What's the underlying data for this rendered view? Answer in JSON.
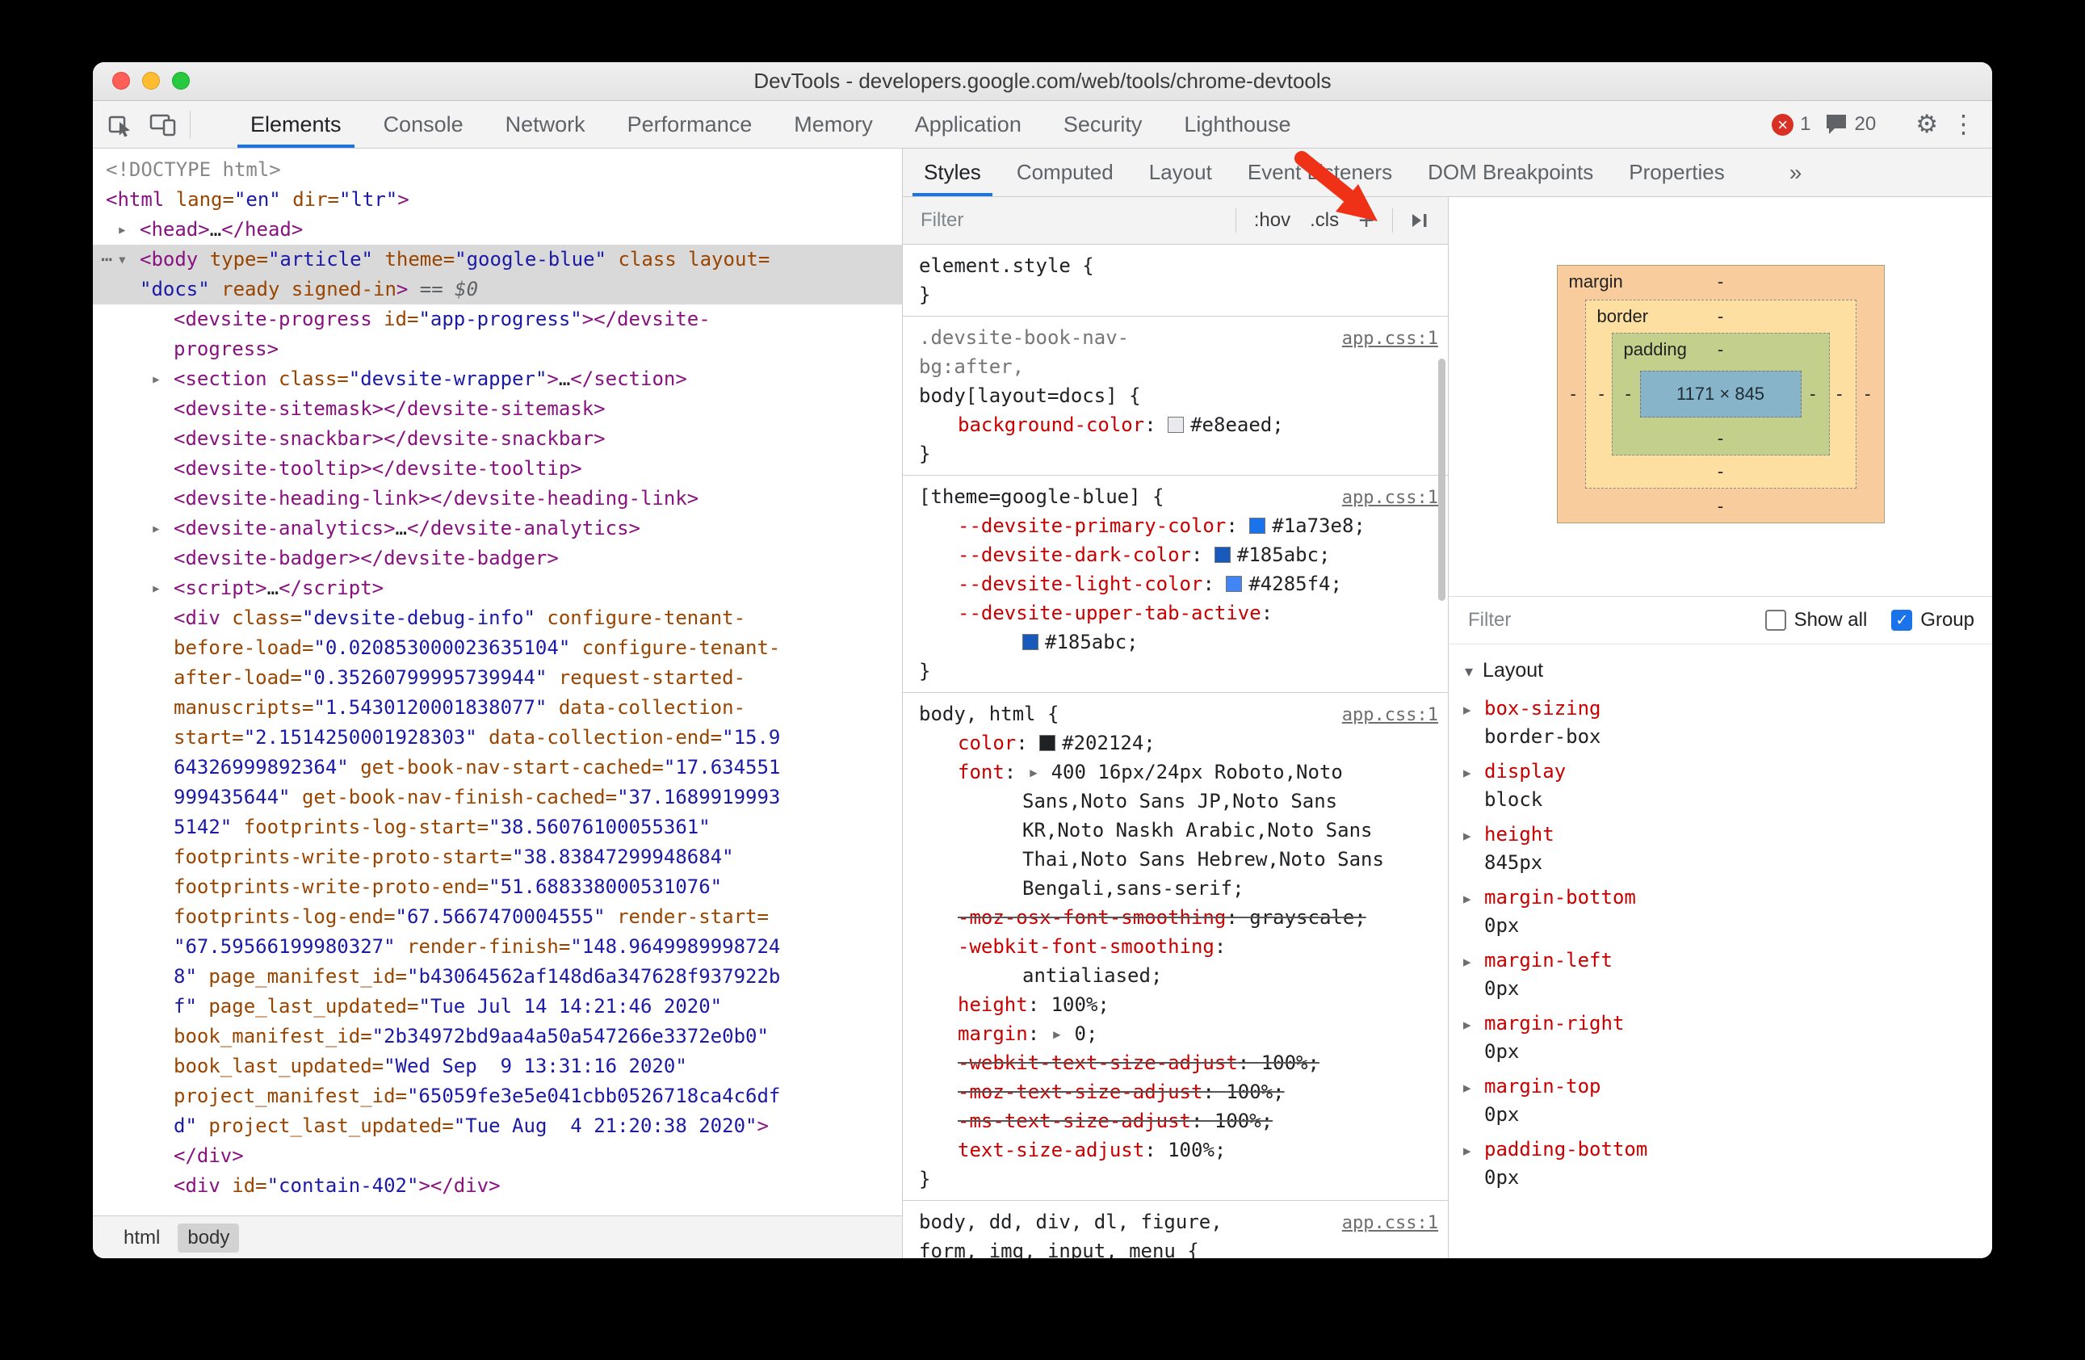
{
  "window": {
    "title": "DevTools - developers.google.com/web/tools/chrome-devtools"
  },
  "colors": {
    "accent": "#1a73e8",
    "error": "#d93025",
    "annotation_arrow": "#ee3117"
  },
  "icons": {
    "expand": "▸",
    "collapse": "▾",
    "more": "⋯",
    "gear": "⚙",
    "kebab": "⋮",
    "close": "×",
    "check": "✓"
  },
  "toolbar": {
    "tabs": [
      {
        "label": "Elements",
        "active": true
      },
      {
        "label": "Console"
      },
      {
        "label": "Network"
      },
      {
        "label": "Performance"
      },
      {
        "label": "Memory"
      },
      {
        "label": "Application"
      },
      {
        "label": "Security"
      },
      {
        "label": "Lighthouse"
      }
    ],
    "error_count": "1",
    "issue_count": "20"
  },
  "sidebar": {
    "tabs": [
      {
        "label": "Styles",
        "active": true
      },
      {
        "label": "Computed"
      },
      {
        "label": "Layout"
      },
      {
        "label": "Event Listeners"
      },
      {
        "label": "DOM Breakpoints"
      },
      {
        "label": "Properties"
      }
    ],
    "overflow": "»"
  },
  "elements_pane": {
    "lines": [
      {
        "i": 0,
        "s": [
          [
            "g",
            "<!DOCTYPE html>"
          ]
        ]
      },
      {
        "i": 0,
        "s": [
          [
            "t",
            "<html"
          ],
          [
            "a",
            " lang="
          ],
          [
            "v",
            "\"en\""
          ],
          [
            "a",
            " dir="
          ],
          [
            "v",
            "\"ltr\""
          ],
          [
            "t",
            ">"
          ]
        ]
      },
      {
        "i": 1,
        "arrow": "r",
        "s": [
          [
            "t",
            "<head>"
          ],
          [
            "p",
            "…"
          ],
          [
            "t",
            "</head>"
          ]
        ]
      },
      {
        "i": 1,
        "arrow": "d",
        "gutter": "⋯",
        "sel": true,
        "s": [
          [
            "t",
            "<body"
          ],
          [
            "a",
            " type="
          ],
          [
            "v",
            "\"article\""
          ],
          [
            "a",
            " theme="
          ],
          [
            "v",
            "\"google-blue\""
          ],
          [
            "a",
            " class"
          ],
          [
            "a",
            " layout="
          ],
          [
            "v",
            "\n\"docs\""
          ],
          [
            "a",
            " ready"
          ],
          [
            "a",
            " signed-in"
          ],
          [
            "t",
            ">"
          ],
          [
            "d",
            " == "
          ],
          [
            "di",
            "$0"
          ]
        ]
      },
      {
        "i": 2,
        "s": [
          [
            "t",
            "<devsite-progress"
          ],
          [
            "a",
            " id="
          ],
          [
            "v",
            "\"app-progress\""
          ],
          [
            "t",
            "></devsite-\nprogress>"
          ]
        ]
      },
      {
        "i": 2,
        "arrow": "r",
        "s": [
          [
            "t",
            "<section"
          ],
          [
            "a",
            " class="
          ],
          [
            "v",
            "\"devsite-wrapper\""
          ],
          [
            "t",
            ">"
          ],
          [
            "p",
            "…"
          ],
          [
            "t",
            "</section>"
          ]
        ]
      },
      {
        "i": 2,
        "s": [
          [
            "t",
            "<devsite-sitemask></devsite-sitemask>"
          ]
        ]
      },
      {
        "i": 2,
        "s": [
          [
            "t",
            "<devsite-snackbar></devsite-snackbar>"
          ]
        ]
      },
      {
        "i": 2,
        "s": [
          [
            "t",
            "<devsite-tooltip></devsite-tooltip>"
          ]
        ]
      },
      {
        "i": 2,
        "s": [
          [
            "t",
            "<devsite-heading-link></devsite-heading-link>"
          ]
        ]
      },
      {
        "i": 2,
        "arrow": "r",
        "s": [
          [
            "t",
            "<devsite-analytics>"
          ],
          [
            "p",
            "…"
          ],
          [
            "t",
            "</devsite-analytics>"
          ]
        ]
      },
      {
        "i": 2,
        "s": [
          [
            "t",
            "<devsite-badger></devsite-badger>"
          ]
        ]
      },
      {
        "i": 2,
        "arrow": "r",
        "s": [
          [
            "t",
            "<script>"
          ],
          [
            "p",
            "…"
          ],
          [
            "t",
            "</script>"
          ]
        ]
      },
      {
        "i": 2,
        "s": [
          [
            "t",
            "<div"
          ],
          [
            "a",
            " class="
          ],
          [
            "v",
            "\"devsite-debug-info\""
          ],
          [
            "a",
            " configure-tenant-\nbefore-load="
          ],
          [
            "v",
            "\"0.020853000023635104\""
          ],
          [
            "a",
            " configure-tenant-\nafter-load="
          ],
          [
            "v",
            "\"0.35260799995739944\""
          ],
          [
            "a",
            " request-started-\nmanuscripts="
          ],
          [
            "v",
            "\"1.5430120001838077\""
          ],
          [
            "a",
            " data-collection-\nstart="
          ],
          [
            "v",
            "\"2.1514250001928303\""
          ],
          [
            "a",
            " data-collection-end="
          ],
          [
            "v",
            "\"15.9\n64326999892364\""
          ],
          [
            "a",
            " get-book-nav-start-cached="
          ],
          [
            "v",
            "\"17.634551\n999435644\""
          ],
          [
            "a",
            " get-book-nav-finish-cached="
          ],
          [
            "v",
            "\"37.1689919993\n5142\""
          ],
          [
            "a",
            " footprints-log-start="
          ],
          [
            "v",
            "\"38.56076100055361\""
          ],
          [
            "a",
            "\nfootprints-write-proto-start="
          ],
          [
            "v",
            "\"38.83847299948684\""
          ],
          [
            "a",
            "\nfootprints-write-proto-end="
          ],
          [
            "v",
            "\"51.688338000531076\""
          ],
          [
            "a",
            "\nfootprints-log-end="
          ],
          [
            "v",
            "\"67.5667470004555\""
          ],
          [
            "a",
            " render-start="
          ],
          [
            "v",
            "\n\"67.59566199980327\""
          ],
          [
            "a",
            " render-finish="
          ],
          [
            "v",
            "\"148.9649989998724\n8\""
          ],
          [
            "a",
            " page_manifest_id="
          ],
          [
            "v",
            "\"b43064562af148d6a347628f937922b\nf\""
          ],
          [
            "a",
            " page_last_updated="
          ],
          [
            "v",
            "\"Tue Jul 14 14:21:46 2020\""
          ],
          [
            "a",
            "\nbook_manifest_id="
          ],
          [
            "v",
            "\"2b34972bd9aa4a50a547266e3372e0b0\""
          ],
          [
            "a",
            "\nbook_last_updated="
          ],
          [
            "v",
            "\"Wed Sep  9 13:31:16 2020\""
          ],
          [
            "a",
            "\nproject_manifest_id="
          ],
          [
            "v",
            "\"65059fe3e5e041cbb0526718ca4c6df\nd\""
          ],
          [
            "a",
            " project_last_updated="
          ],
          [
            "v",
            "\"Tue Aug  4 21:20:38 2020\""
          ],
          [
            "t",
            ">"
          ]
        ]
      },
      {
        "i": 2,
        "s": [
          [
            "t",
            "</div>"
          ]
        ]
      },
      {
        "i": 2,
        "s": [
          [
            "t",
            "<div"
          ],
          [
            "a",
            " id="
          ],
          [
            "v",
            "\"contain-402\""
          ],
          [
            "t",
            "></div>"
          ]
        ]
      }
    ],
    "breadcrumbs": [
      {
        "label": "html"
      },
      {
        "label": "body",
        "selected": true
      }
    ]
  },
  "styles_pane": {
    "filter_placeholder": "Filter",
    "state_toggles": [
      ":hov",
      ".cls"
    ],
    "new_rule_label": "+",
    "rules": [
      {
        "link": null,
        "lines": [
          {
            "i": 0,
            "s": [
              [
                "sel",
                "element.style"
              ],
              [
                "p",
                " {"
              ]
            ]
          },
          {
            "i": 0,
            "s": [
              [
                "p",
                "}"
              ]
            ]
          }
        ]
      },
      {
        "link": "app.css:1",
        "lines": [
          {
            "i": 0,
            "s": [
              [
                "dsel",
                ".devsite-book-nav-"
              ]
            ]
          },
          {
            "i": 0,
            "s": [
              [
                "dsel",
                "bg:after,"
              ]
            ]
          },
          {
            "i": 0,
            "s": [
              [
                "sel",
                "body[layout=docs]"
              ],
              [
                "p",
                " {"
              ]
            ]
          },
          {
            "i": 1,
            "s": [
              [
                "prop",
                "background-color"
              ],
              [
                "p",
                ": "
              ],
              [
                "sw",
                "#e8eaed"
              ],
              [
                "val",
                "#e8eaed;"
              ]
            ]
          },
          {
            "i": 0,
            "s": [
              [
                "p",
                "}"
              ]
            ]
          }
        ]
      },
      {
        "link": "app.css:1",
        "lines": [
          {
            "i": 0,
            "s": [
              [
                "sel",
                "[theme=google-blue]"
              ],
              [
                "p",
                " {"
              ]
            ]
          },
          {
            "i": 1,
            "s": [
              [
                "prop",
                "--devsite-primary-color"
              ],
              [
                "p",
                ": "
              ],
              [
                "sw",
                "#1a73e8"
              ],
              [
                "val",
                "#1a73e8;"
              ]
            ]
          },
          {
            "i": 1,
            "s": [
              [
                "prop",
                "--devsite-dark-color"
              ],
              [
                "p",
                ": "
              ],
              [
                "sw",
                "#185abc"
              ],
              [
                "val",
                "#185abc;"
              ]
            ]
          },
          {
            "i": 1,
            "s": [
              [
                "prop",
                "--devsite-light-color"
              ],
              [
                "p",
                ": "
              ],
              [
                "sw",
                "#4285f4"
              ],
              [
                "val",
                "#4285f4;"
              ]
            ]
          },
          {
            "i": 1,
            "s": [
              [
                "prop",
                "--devsite-upper-tab-active"
              ],
              [
                "p",
                ":"
              ]
            ]
          },
          {
            "i": 2,
            "s": [
              [
                "sw",
                "#185abc"
              ],
              [
                "val",
                "#185abc;"
              ]
            ]
          },
          {
            "i": 0,
            "s": [
              [
                "p",
                "}"
              ]
            ]
          }
        ]
      },
      {
        "link": "app.css:1",
        "lines": [
          {
            "i": 0,
            "s": [
              [
                "sel",
                "body, html"
              ],
              [
                "p",
                " {"
              ]
            ]
          },
          {
            "i": 1,
            "s": [
              [
                "prop",
                "color"
              ],
              [
                "p",
                ": "
              ],
              [
                "sw",
                "#202124"
              ],
              [
                "val",
                "#202124;"
              ]
            ]
          },
          {
            "i": 1,
            "s": [
              [
                "prop",
                "font"
              ],
              [
                "p",
                ": "
              ],
              [
                "arr",
                "▸ "
              ],
              [
                "val",
                "400 16px/24px Roboto,Noto"
              ]
            ]
          },
          {
            "i": 2,
            "s": [
              [
                "val",
                "Sans,Noto Sans JP,Noto Sans"
              ]
            ]
          },
          {
            "i": 2,
            "s": [
              [
                "val",
                "KR,Noto Naskh Arabic,Noto Sans"
              ]
            ]
          },
          {
            "i": 2,
            "s": [
              [
                "val",
                "Thai,Noto Sans Hebrew,Noto Sans"
              ]
            ]
          },
          {
            "i": 2,
            "s": [
              [
                "val",
                "Bengali,sans-serif;"
              ]
            ]
          },
          {
            "i": 1,
            "strike": true,
            "s": [
              [
                "prop",
                "-moz-osx-font-smoothing"
              ],
              [
                "p",
                ": "
              ],
              [
                "val",
                "grayscale;"
              ]
            ]
          },
          {
            "i": 1,
            "s": [
              [
                "prop",
                "-webkit-font-smoothing"
              ],
              [
                "p",
                ":"
              ]
            ]
          },
          {
            "i": 2,
            "s": [
              [
                "val",
                "antialiased;"
              ]
            ]
          },
          {
            "i": 1,
            "s": [
              [
                "prop",
                "height"
              ],
              [
                "p",
                ": "
              ],
              [
                "val",
                "100%;"
              ]
            ]
          },
          {
            "i": 1,
            "s": [
              [
                "prop",
                "margin"
              ],
              [
                "p",
                ": "
              ],
              [
                "arr",
                "▸ "
              ],
              [
                "val",
                "0;"
              ]
            ]
          },
          {
            "i": 1,
            "strike": true,
            "s": [
              [
                "prop",
                "-webkit-text-size-adjust"
              ],
              [
                "p",
                ": "
              ],
              [
                "val",
                "100%;"
              ]
            ]
          },
          {
            "i": 1,
            "strike": true,
            "s": [
              [
                "prop",
                "-moz-text-size-adjust"
              ],
              [
                "p",
                ": "
              ],
              [
                "val",
                "100%;"
              ]
            ]
          },
          {
            "i": 1,
            "strike": true,
            "s": [
              [
                "prop",
                "-ms-text-size-adjust"
              ],
              [
                "p",
                ": "
              ],
              [
                "val",
                "100%;"
              ]
            ]
          },
          {
            "i": 1,
            "s": [
              [
                "prop",
                "text-size-adjust"
              ],
              [
                "p",
                ": "
              ],
              [
                "val",
                "100%;"
              ]
            ]
          },
          {
            "i": 0,
            "s": [
              [
                "p",
                "}"
              ]
            ]
          }
        ]
      },
      {
        "link": "app.css:1",
        "lines": [
          {
            "i": 0,
            "s": [
              [
                "sel",
                "body, dd, div, dl, figure,"
              ]
            ]
          },
          {
            "i": 0,
            "s": [
              [
                "sel",
                "form, img, input, menu"
              ],
              [
                "p",
                " {"
              ]
            ]
          }
        ]
      }
    ]
  },
  "box_model": {
    "margin_label": "margin",
    "border_label": "border",
    "padding_label": "padding",
    "content_size": "1171 × 845",
    "dash": "-"
  },
  "computed_pane": {
    "filter_placeholder": "Filter",
    "show_all_label": "Show all",
    "show_all_checked": false,
    "group_label": "Group",
    "group_checked": true,
    "group_header": "Layout",
    "properties": [
      {
        "name": "box-sizing",
        "value": "border-box"
      },
      {
        "name": "display",
        "value": "block"
      },
      {
        "name": "height",
        "value": "845px"
      },
      {
        "name": "margin-bottom",
        "value": "0px"
      },
      {
        "name": "margin-left",
        "value": "0px"
      },
      {
        "name": "margin-right",
        "value": "0px"
      },
      {
        "name": "margin-top",
        "value": "0px"
      },
      {
        "name": "padding-bottom",
        "value": "0px"
      }
    ]
  }
}
